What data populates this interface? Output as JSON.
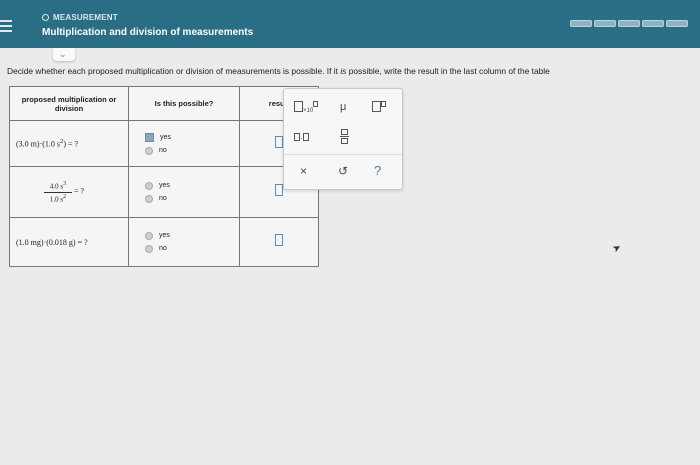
{
  "header": {
    "topic": "MEASUREMENT",
    "title": "Multiplication and division of measurements"
  },
  "instructions": {
    "pre": "Decide whether each proposed multiplication or division of measurements is possible. If it ",
    "italic": "is",
    "post": " possible, write the result in the last column of the table"
  },
  "table": {
    "headers": {
      "proposed": "proposed multiplication or division",
      "possible": "Is this possible?",
      "result": "result"
    },
    "rows": [
      {
        "expr_a": "3.0 m",
        "expr_b": "1.0 s",
        "exp": "2",
        "selected": "yes"
      },
      {
        "num": "4.0 s",
        "num_exp": "3",
        "den": "1.0 s",
        "den_exp": "2"
      },
      {
        "expr_a": "1.0 mg",
        "expr_b": "0.018 g"
      }
    ],
    "yes_label": "yes",
    "no_label": "no",
    "eq": "= ?"
  },
  "palette": {
    "x10": "×10",
    "mu": "μ",
    "dot": "·",
    "clear": "×",
    "undo": "↺",
    "help": "?"
  },
  "colors": {
    "header_bg": "#2a6e86",
    "accent": "#5a8fa6"
  }
}
